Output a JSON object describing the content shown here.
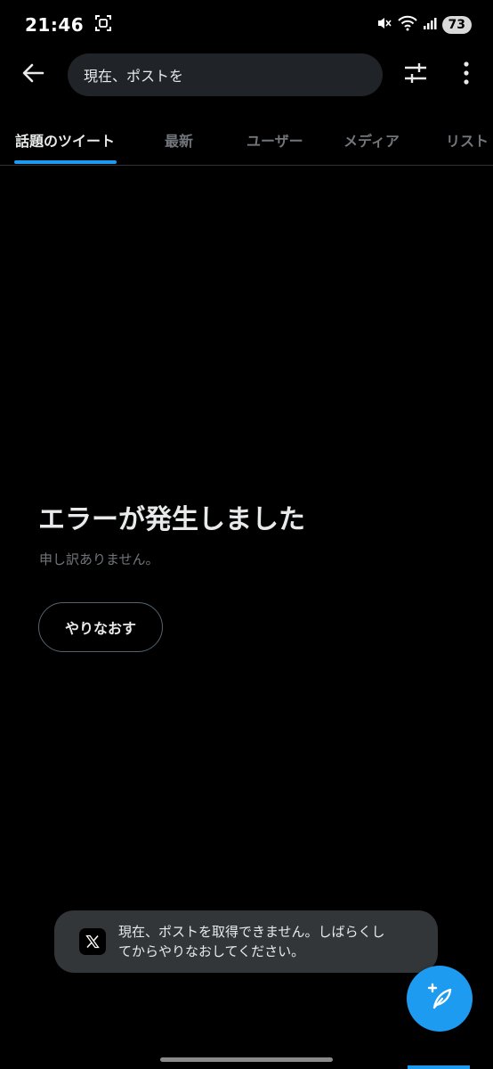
{
  "status_bar": {
    "time": "21:46",
    "battery": "73",
    "icons": [
      "screenshot-icon",
      "mute-icon",
      "wifi-icon",
      "signal-icon"
    ]
  },
  "top_bar": {
    "search_value": "現在、ポストを",
    "icons": [
      "back-arrow-icon",
      "filter-sliders-icon",
      "more-vertical-icon"
    ]
  },
  "tabs": [
    {
      "label": "話題のツイート",
      "active": true
    },
    {
      "label": "最新",
      "active": false
    },
    {
      "label": "ユーザー",
      "active": false
    },
    {
      "label": "メディア",
      "active": false
    },
    {
      "label": "リスト",
      "active": false
    }
  ],
  "error": {
    "title": "エラーが発生しました",
    "subtitle": "申し訳ありません。",
    "retry_label": "やりなおす"
  },
  "toast": {
    "line1": "現在、ポストを取得できません。しばらくし",
    "line2": "てからやりなおしてください。",
    "icon": "x-logo-icon"
  },
  "fab": {
    "icon": "compose-feather-icon"
  },
  "colors": {
    "accent": "#1d9bf0",
    "background": "#000000",
    "text_primary": "#e7e9ea",
    "text_secondary": "#71767b",
    "search_bg": "#202327",
    "toast_bg": "#333639"
  }
}
